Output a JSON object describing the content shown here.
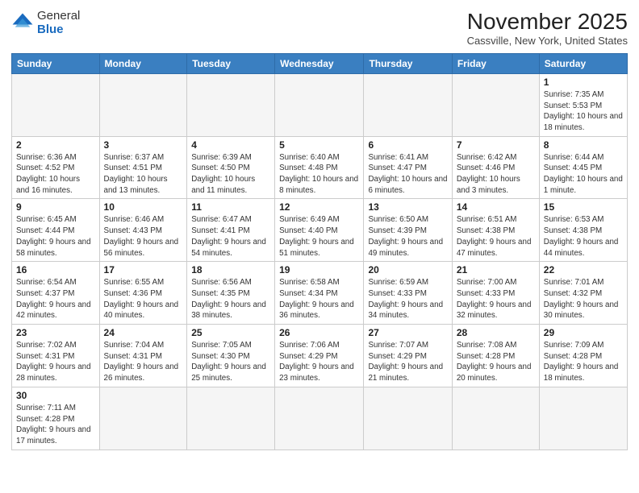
{
  "header": {
    "logo_general": "General",
    "logo_blue": "Blue",
    "month_title": "November 2025",
    "subtitle": "Cassville, New York, United States"
  },
  "days_of_week": [
    "Sunday",
    "Monday",
    "Tuesday",
    "Wednesday",
    "Thursday",
    "Friday",
    "Saturday"
  ],
  "weeks": [
    [
      {
        "day": "",
        "info": ""
      },
      {
        "day": "",
        "info": ""
      },
      {
        "day": "",
        "info": ""
      },
      {
        "day": "",
        "info": ""
      },
      {
        "day": "",
        "info": ""
      },
      {
        "day": "",
        "info": ""
      },
      {
        "day": "1",
        "info": "Sunrise: 7:35 AM\nSunset: 5:53 PM\nDaylight: 10 hours\nand 18 minutes."
      }
    ],
    [
      {
        "day": "2",
        "info": "Sunrise: 6:36 AM\nSunset: 4:52 PM\nDaylight: 10 hours\nand 16 minutes."
      },
      {
        "day": "3",
        "info": "Sunrise: 6:37 AM\nSunset: 4:51 PM\nDaylight: 10 hours\nand 13 minutes."
      },
      {
        "day": "4",
        "info": "Sunrise: 6:39 AM\nSunset: 4:50 PM\nDaylight: 10 hours\nand 11 minutes."
      },
      {
        "day": "5",
        "info": "Sunrise: 6:40 AM\nSunset: 4:48 PM\nDaylight: 10 hours\nand 8 minutes."
      },
      {
        "day": "6",
        "info": "Sunrise: 6:41 AM\nSunset: 4:47 PM\nDaylight: 10 hours\nand 6 minutes."
      },
      {
        "day": "7",
        "info": "Sunrise: 6:42 AM\nSunset: 4:46 PM\nDaylight: 10 hours\nand 3 minutes."
      },
      {
        "day": "8",
        "info": "Sunrise: 6:44 AM\nSunset: 4:45 PM\nDaylight: 10 hours\nand 1 minute."
      }
    ],
    [
      {
        "day": "9",
        "info": "Sunrise: 6:45 AM\nSunset: 4:44 PM\nDaylight: 9 hours\nand 58 minutes."
      },
      {
        "day": "10",
        "info": "Sunrise: 6:46 AM\nSunset: 4:43 PM\nDaylight: 9 hours\nand 56 minutes."
      },
      {
        "day": "11",
        "info": "Sunrise: 6:47 AM\nSunset: 4:41 PM\nDaylight: 9 hours\nand 54 minutes."
      },
      {
        "day": "12",
        "info": "Sunrise: 6:49 AM\nSunset: 4:40 PM\nDaylight: 9 hours\nand 51 minutes."
      },
      {
        "day": "13",
        "info": "Sunrise: 6:50 AM\nSunset: 4:39 PM\nDaylight: 9 hours\nand 49 minutes."
      },
      {
        "day": "14",
        "info": "Sunrise: 6:51 AM\nSunset: 4:38 PM\nDaylight: 9 hours\nand 47 minutes."
      },
      {
        "day": "15",
        "info": "Sunrise: 6:53 AM\nSunset: 4:38 PM\nDaylight: 9 hours\nand 44 minutes."
      }
    ],
    [
      {
        "day": "16",
        "info": "Sunrise: 6:54 AM\nSunset: 4:37 PM\nDaylight: 9 hours\nand 42 minutes."
      },
      {
        "day": "17",
        "info": "Sunrise: 6:55 AM\nSunset: 4:36 PM\nDaylight: 9 hours\nand 40 minutes."
      },
      {
        "day": "18",
        "info": "Sunrise: 6:56 AM\nSunset: 4:35 PM\nDaylight: 9 hours\nand 38 minutes."
      },
      {
        "day": "19",
        "info": "Sunrise: 6:58 AM\nSunset: 4:34 PM\nDaylight: 9 hours\nand 36 minutes."
      },
      {
        "day": "20",
        "info": "Sunrise: 6:59 AM\nSunset: 4:33 PM\nDaylight: 9 hours\nand 34 minutes."
      },
      {
        "day": "21",
        "info": "Sunrise: 7:00 AM\nSunset: 4:33 PM\nDaylight: 9 hours\nand 32 minutes."
      },
      {
        "day": "22",
        "info": "Sunrise: 7:01 AM\nSunset: 4:32 PM\nDaylight: 9 hours\nand 30 minutes."
      }
    ],
    [
      {
        "day": "23",
        "info": "Sunrise: 7:02 AM\nSunset: 4:31 PM\nDaylight: 9 hours\nand 28 minutes."
      },
      {
        "day": "24",
        "info": "Sunrise: 7:04 AM\nSunset: 4:31 PM\nDaylight: 9 hours\nand 26 minutes."
      },
      {
        "day": "25",
        "info": "Sunrise: 7:05 AM\nSunset: 4:30 PM\nDaylight: 9 hours\nand 25 minutes."
      },
      {
        "day": "26",
        "info": "Sunrise: 7:06 AM\nSunset: 4:29 PM\nDaylight: 9 hours\nand 23 minutes."
      },
      {
        "day": "27",
        "info": "Sunrise: 7:07 AM\nSunset: 4:29 PM\nDaylight: 9 hours\nand 21 minutes."
      },
      {
        "day": "28",
        "info": "Sunrise: 7:08 AM\nSunset: 4:28 PM\nDaylight: 9 hours\nand 20 minutes."
      },
      {
        "day": "29",
        "info": "Sunrise: 7:09 AM\nSunset: 4:28 PM\nDaylight: 9 hours\nand 18 minutes."
      }
    ],
    [
      {
        "day": "30",
        "info": "Sunrise: 7:11 AM\nSunset: 4:28 PM\nDaylight: 9 hours\nand 17 minutes."
      },
      {
        "day": "",
        "info": ""
      },
      {
        "day": "",
        "info": ""
      },
      {
        "day": "",
        "info": ""
      },
      {
        "day": "",
        "info": ""
      },
      {
        "day": "",
        "info": ""
      },
      {
        "day": "",
        "info": ""
      }
    ]
  ]
}
